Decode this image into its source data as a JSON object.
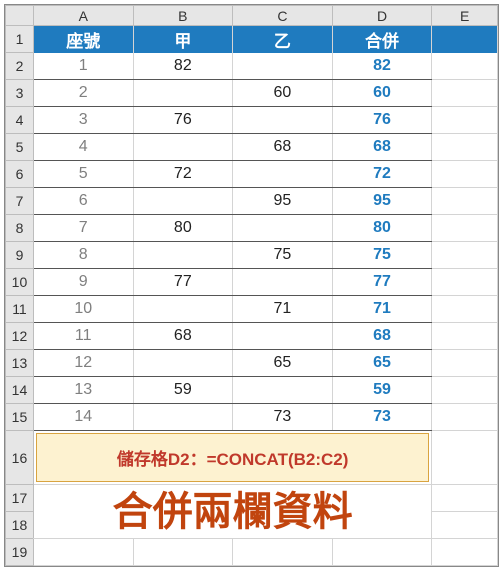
{
  "columns": [
    "A",
    "B",
    "C",
    "D",
    "E"
  ],
  "row_numbers": [
    1,
    2,
    3,
    4,
    5,
    6,
    7,
    8,
    9,
    10,
    11,
    12,
    13,
    14,
    15,
    16,
    17,
    18,
    19
  ],
  "header_row": {
    "A": "座號",
    "B": "甲",
    "C": "乙",
    "D": "合併"
  },
  "data_rows": [
    {
      "A": "1",
      "B": "82",
      "C": "",
      "D": "82"
    },
    {
      "A": "2",
      "B": "",
      "C": "60",
      "D": "60"
    },
    {
      "A": "3",
      "B": "76",
      "C": "",
      "D": "76"
    },
    {
      "A": "4",
      "B": "",
      "C": "68",
      "D": "68"
    },
    {
      "A": "5",
      "B": "72",
      "C": "",
      "D": "72"
    },
    {
      "A": "6",
      "B": "",
      "C": "95",
      "D": "95"
    },
    {
      "A": "7",
      "B": "80",
      "C": "",
      "D": "80"
    },
    {
      "A": "8",
      "B": "",
      "C": "75",
      "D": "75"
    },
    {
      "A": "9",
      "B": "77",
      "C": "",
      "D": "77"
    },
    {
      "A": "10",
      "B": "",
      "C": "71",
      "D": "71"
    },
    {
      "A": "11",
      "B": "68",
      "C": "",
      "D": "68"
    },
    {
      "A": "12",
      "B": "",
      "C": "65",
      "D": "65"
    },
    {
      "A": "13",
      "B": "59",
      "C": "",
      "D": "59"
    },
    {
      "A": "14",
      "B": "",
      "C": "73",
      "D": "73"
    }
  ],
  "formula_text": "儲存格D2：=CONCAT(B2:C2)",
  "big_title": "合併兩欄資料"
}
